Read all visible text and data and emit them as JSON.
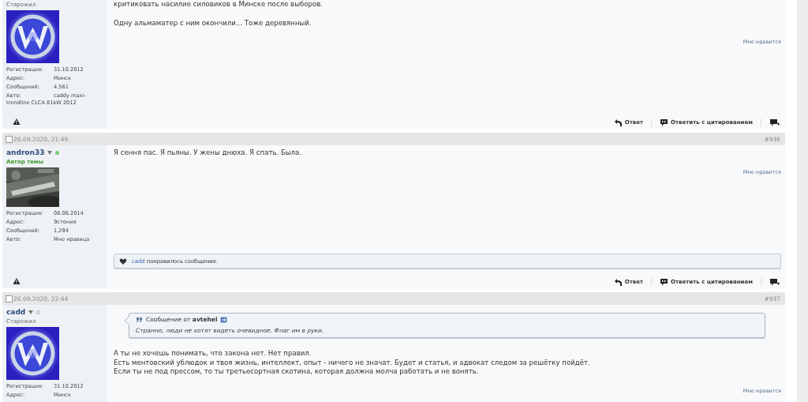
{
  "posts": [
    {
      "rank": "Старожил",
      "rank_highlight": false,
      "avatar": {
        "kind": "picture"
      },
      "fields": [
        {
          "label": "Регистрация:",
          "value": "31.10.2012"
        },
        {
          "label": "Адрес:",
          "value": "Минск"
        },
        {
          "label": "Сообщений:",
          "value": "4,561"
        },
        {
          "label": "Авто:",
          "value": "caddy maxi-trendline CLCA 81kW 2012"
        }
      ],
      "paragraphs": [
        "критиковать насилие силовиков в Минске после выборов.",
        "Одну альмаматер с ним окончили... Тоже деревянный."
      ],
      "like_link": "Мне нравится",
      "actions": {
        "reply": "Ответ",
        "quote": "Ответить с цитированием"
      }
    },
    {
      "date": "26.09.2020, 21:49",
      "checked": false,
      "number": "#936",
      "author": "andron33",
      "online": true,
      "rank": "Автор темы",
      "rank_highlight": true,
      "avatar": {
        "kind": "picture"
      },
      "fields": [
        {
          "label": "Регистрация:",
          "value": "08.06.2014"
        },
        {
          "label": "Адрес:",
          "value": "Эстония"
        },
        {
          "label": "Сообщений:",
          "value": "1,294"
        },
        {
          "label": "Авто:",
          "value": "Мне нравица"
        }
      ],
      "paragraphs": [
        "Я сення пас. Я пьяны. У жены днюха. Я спать. Была."
      ],
      "like_link": "Мне нравится",
      "likes": {
        "user": "cadd",
        "text": "понравилось сообщение."
      },
      "actions": {
        "reply": "Ответ",
        "quote": "Ответить с цитированием"
      }
    },
    {
      "date": "26.09.2020, 22:44",
      "checked": false,
      "number": "#937",
      "author": "cadd",
      "online": false,
      "rank": "Старожил",
      "rank_highlight": false,
      "avatar": {
        "kind": "picture"
      },
      "fields": [
        {
          "label": "Регистрация:",
          "value": "31.10.2012"
        },
        {
          "label": "Адрес:",
          "value": "Минск"
        }
      ],
      "quote": {
        "heading": "Сообщение от **avtehel**",
        "text": "Странно, люди не хотят видеть очевидное. Флаг им в руки."
      },
      "paragraphs": [
        "А ты не хочешь понимать, что закона нет. Нет правил.\nЕсть ментовский ублюдок и твоя жизнь, интеллект, опыт - ничего не значат. Будет и статья, и адвокат следом за решётку пойдёт.\nЕсли ты не под прессом, то ты третьесортная скотина, которая должна молча работать и не вонять."
      ],
      "like_link": "Мне нравится"
    }
  ]
}
